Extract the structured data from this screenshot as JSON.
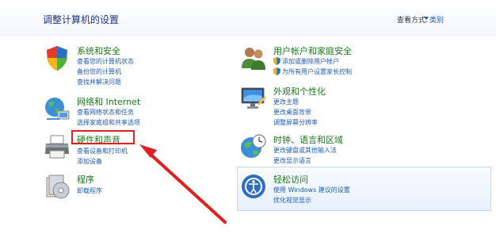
{
  "header": {
    "title": "调整计算机的设置",
    "view_by_label": "查看方式:",
    "view_by_value": "类别"
  },
  "left_column": [
    {
      "title": "系统和安全",
      "icon": "shield-icon",
      "links": [
        "查看您的计算机状态",
        "备份您的计算机",
        "查找并解决问题"
      ]
    },
    {
      "title": "网络和 Internet",
      "icon": "globe-network-icon",
      "links": [
        "查看网络状态和任务",
        "选择家庭组和共享选项"
      ]
    },
    {
      "title": "硬件和声音",
      "icon": "printer-icon",
      "links": [
        "查看设备和打印机",
        "添加设备"
      ]
    },
    {
      "title": "程序",
      "icon": "programs-disc-icon",
      "links": [
        "卸载程序"
      ]
    }
  ],
  "right_column": [
    {
      "title": "用户帐户和家庭安全",
      "icon": "users-icon",
      "links": [
        "添加或删除用户帐户",
        "为所有用户设置家长控制"
      ]
    },
    {
      "title": "外观和个性化",
      "icon": "monitor-icon",
      "links": [
        "更改主题",
        "更改桌面背景",
        "调整屏幕分辨率"
      ]
    },
    {
      "title": "时钟、语言和区域",
      "icon": "clock-globe-icon",
      "links": [
        "更改键盘或其他输入法",
        "更改显示语言"
      ]
    },
    {
      "title": "轻松访问",
      "icon": "ease-of-access-icon",
      "links": [
        "使用 Windows 建议的设置",
        "优化视觉显示"
      ]
    }
  ],
  "colors": {
    "title_blue": "#1e3287",
    "category_green": "#1a7a1a",
    "link_blue": "#1e5cb3",
    "annotation_red": "#e02020"
  }
}
